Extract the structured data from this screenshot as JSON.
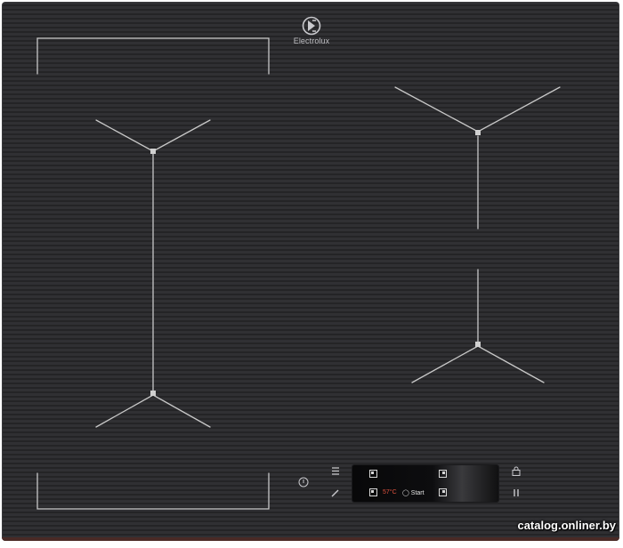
{
  "brand": {
    "name": "Electrolux",
    "logo_icon": "electrolux-logo-icon"
  },
  "control_panel": {
    "temperature": "57°C",
    "start_label": "◯ Start",
    "icons": [
      "menu-icon",
      "edit-icon",
      "power-icon",
      "lock-icon",
      "pause-icon",
      "zone-top-left-icon",
      "zone-top-right-icon",
      "probe-icon",
      "zone-bottom-right-icon"
    ]
  },
  "colors": {
    "glass": "#2d2d2f",
    "zone_lines": "#c8c8c8",
    "temperature": "#e0523e"
  },
  "watermark": "catalog.onliner.by"
}
